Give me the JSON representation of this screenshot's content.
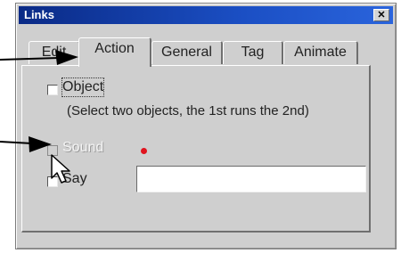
{
  "window": {
    "title": "Links",
    "close_glyph": "✕"
  },
  "tabs": [
    {
      "label": "Edit"
    },
    {
      "label": "Action"
    },
    {
      "label": "General"
    },
    {
      "label": "Tag"
    },
    {
      "label": "Animate"
    }
  ],
  "active_tab": "Action",
  "options": {
    "object": {
      "label": "Object",
      "hint": "(Select two objects, the 1st runs the 2nd)",
      "checked": false,
      "enabled": true
    },
    "sound": {
      "label": "Sound",
      "checked": false,
      "enabled": false,
      "indicator_color": "#e0141e"
    },
    "say": {
      "label": "Say",
      "checked": false,
      "enabled": true,
      "value": ""
    }
  },
  "colors": {
    "titlebar": "#0a2a86",
    "dialog_bg": "#cfcfcf"
  }
}
